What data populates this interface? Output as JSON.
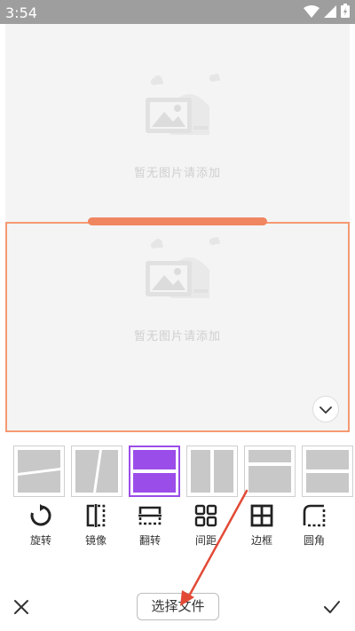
{
  "status_bar": {
    "time": "3:54",
    "icons": [
      "wifi-icon",
      "cell-signal-icon",
      "battery-icon"
    ]
  },
  "frames": [
    {
      "placeholder_text": "暂无图片请添加",
      "icon": "image-placeholder-icon"
    },
    {
      "placeholder_text": "暂无图片请添加",
      "icon": "image-placeholder-icon",
      "selected": true
    }
  ],
  "layouts": [
    {
      "name": "diagonal-horizontal-split"
    },
    {
      "name": "diagonal-vertical-split"
    },
    {
      "name": "horizontal-split",
      "selected": true
    },
    {
      "name": "vertical-split"
    },
    {
      "name": "top-heavy-split"
    },
    {
      "name": "stacked-split-partial"
    }
  ],
  "tools": [
    {
      "label": "旋转",
      "icon": "rotate-icon"
    },
    {
      "label": "镜像",
      "icon": "mirror-icon"
    },
    {
      "label": "翻转",
      "icon": "flip-icon"
    },
    {
      "label": "间距",
      "icon": "spacing-icon"
    },
    {
      "label": "边框",
      "icon": "border-icon"
    },
    {
      "label": "圆角",
      "icon": "rounded-corner-icon"
    }
  ],
  "bottom_bar": {
    "select_file_label": "选择文件"
  },
  "colors": {
    "accent_orange": "#f08660",
    "selected_purple": "#9b4dea",
    "annotation_red": "#e24a36",
    "status_bar_gray": "#9e9e9e"
  }
}
